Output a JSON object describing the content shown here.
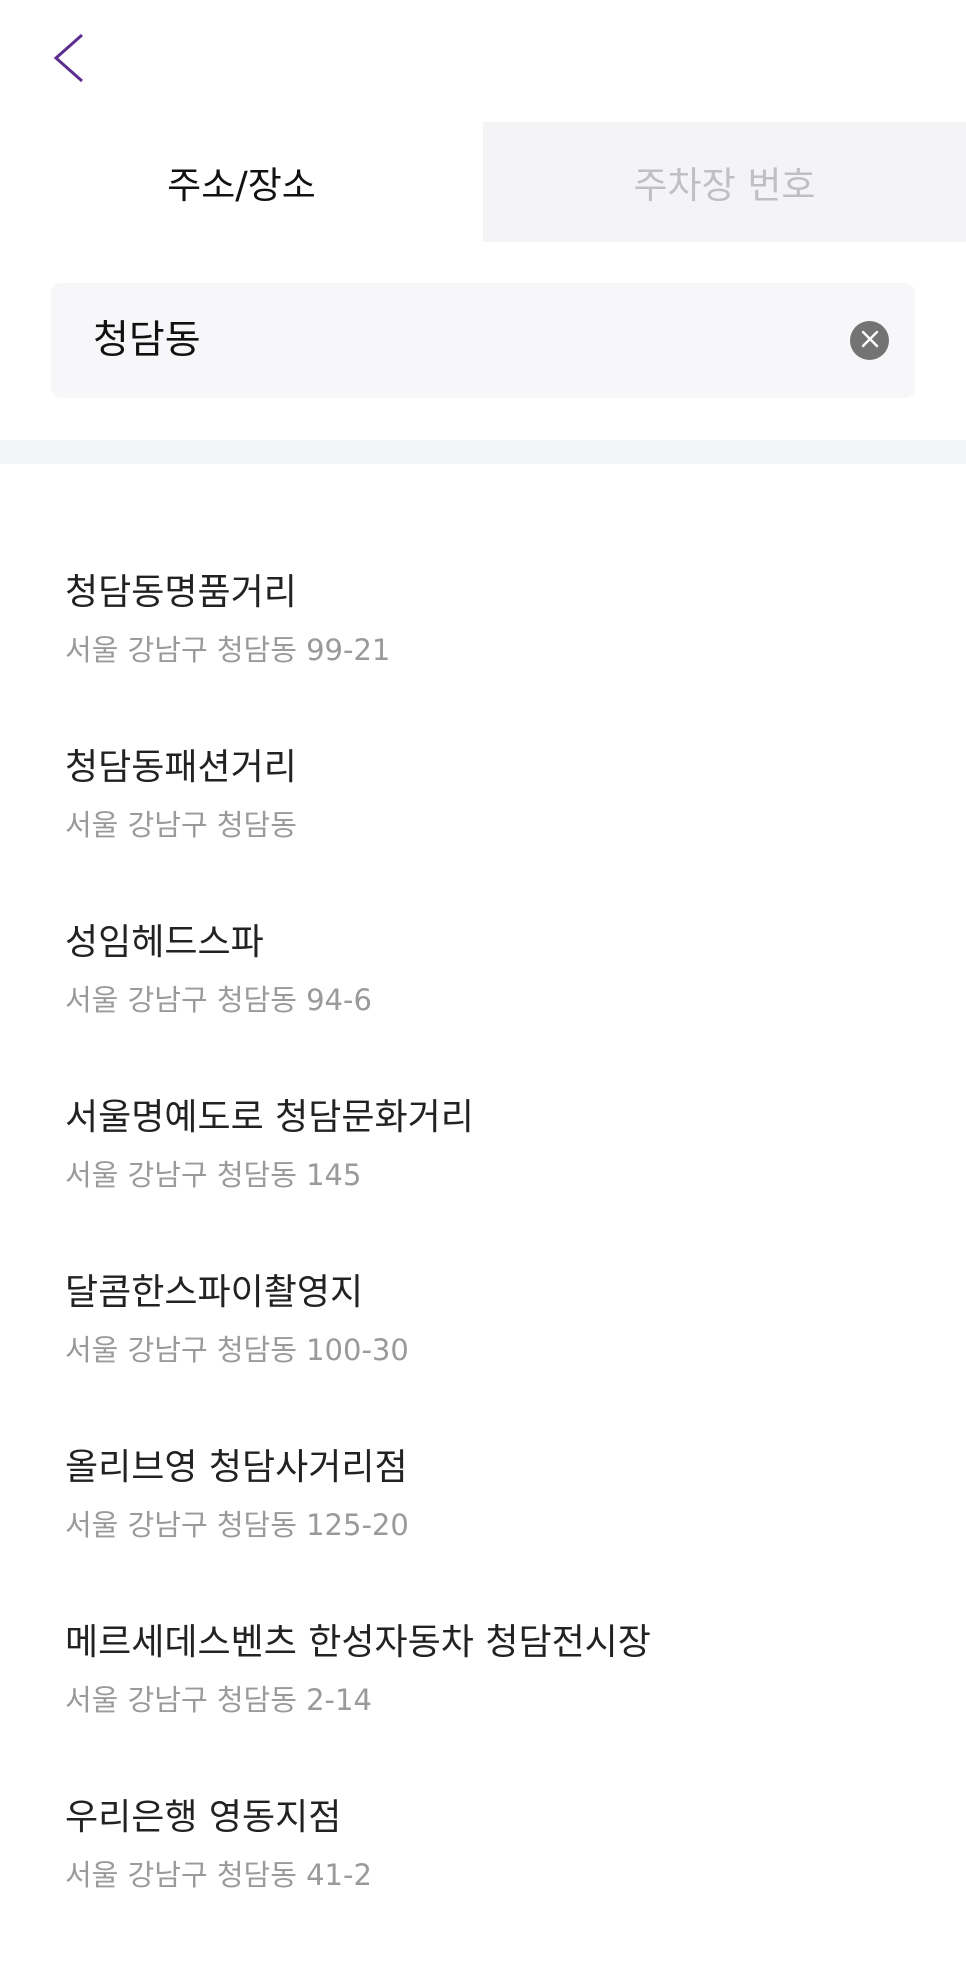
{
  "header": {
    "back_icon": "chevron-left-icon",
    "accent_color": "#5b2d8f"
  },
  "tabs": [
    {
      "label": "주소/장소",
      "active": true
    },
    {
      "label": "주차장 번호",
      "active": false
    }
  ],
  "search": {
    "value": "청담동",
    "placeholder": "",
    "clear_icon": "clear-circle-icon"
  },
  "results": [
    {
      "name": "청담동명품거리",
      "address": "서울 강남구 청담동 99-21"
    },
    {
      "name": "청담동패션거리",
      "address": "서울 강남구 청담동"
    },
    {
      "name": "성임헤드스파",
      "address": "서울 강남구 청담동 94-6"
    },
    {
      "name": "서울명예도로 청담문화거리",
      "address": "서울 강남구 청담동 145"
    },
    {
      "name": "달콤한스파이촬영지",
      "address": "서울 강남구 청담동 100-30"
    },
    {
      "name": "올리브영 청담사거리점",
      "address": "서울 강남구 청담동 125-20"
    },
    {
      "name": "메르세데스벤츠 한성자동차 청담전시장",
      "address": "서울 강남구 청담동 2-14"
    },
    {
      "name": "우리은행 영동지점",
      "address": "서울 강남구 청담동 41-2"
    }
  ]
}
